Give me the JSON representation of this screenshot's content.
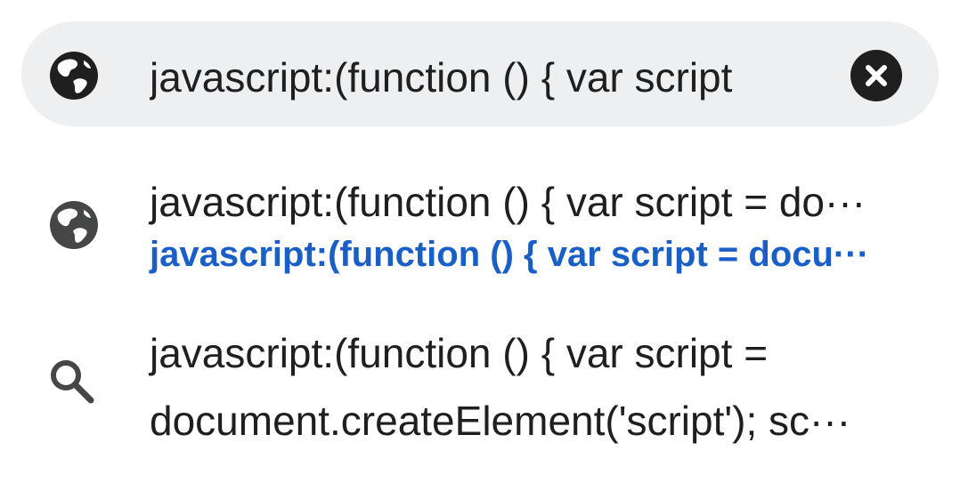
{
  "omnibox": {
    "text": "javascript:(function () { var script",
    "leading_icon": "globe-icon",
    "clear_icon": "close-icon"
  },
  "suggestions": [
    {
      "icon": "globe-icon",
      "title": "javascript:(function () { var script = do···",
      "url": "javascript:(function () { var script = docu···"
    },
    {
      "icon": "search-icon",
      "line1": "javascript:(function () { var script =",
      "line2": "document.createElement('script'); sc···"
    }
  ],
  "colors": {
    "bar_background": "#eeeff1",
    "text": "#1f1f1f",
    "url_blue": "#1a5fc7",
    "icon_dark": "#1f1f1f",
    "icon_grey": "#444746"
  }
}
